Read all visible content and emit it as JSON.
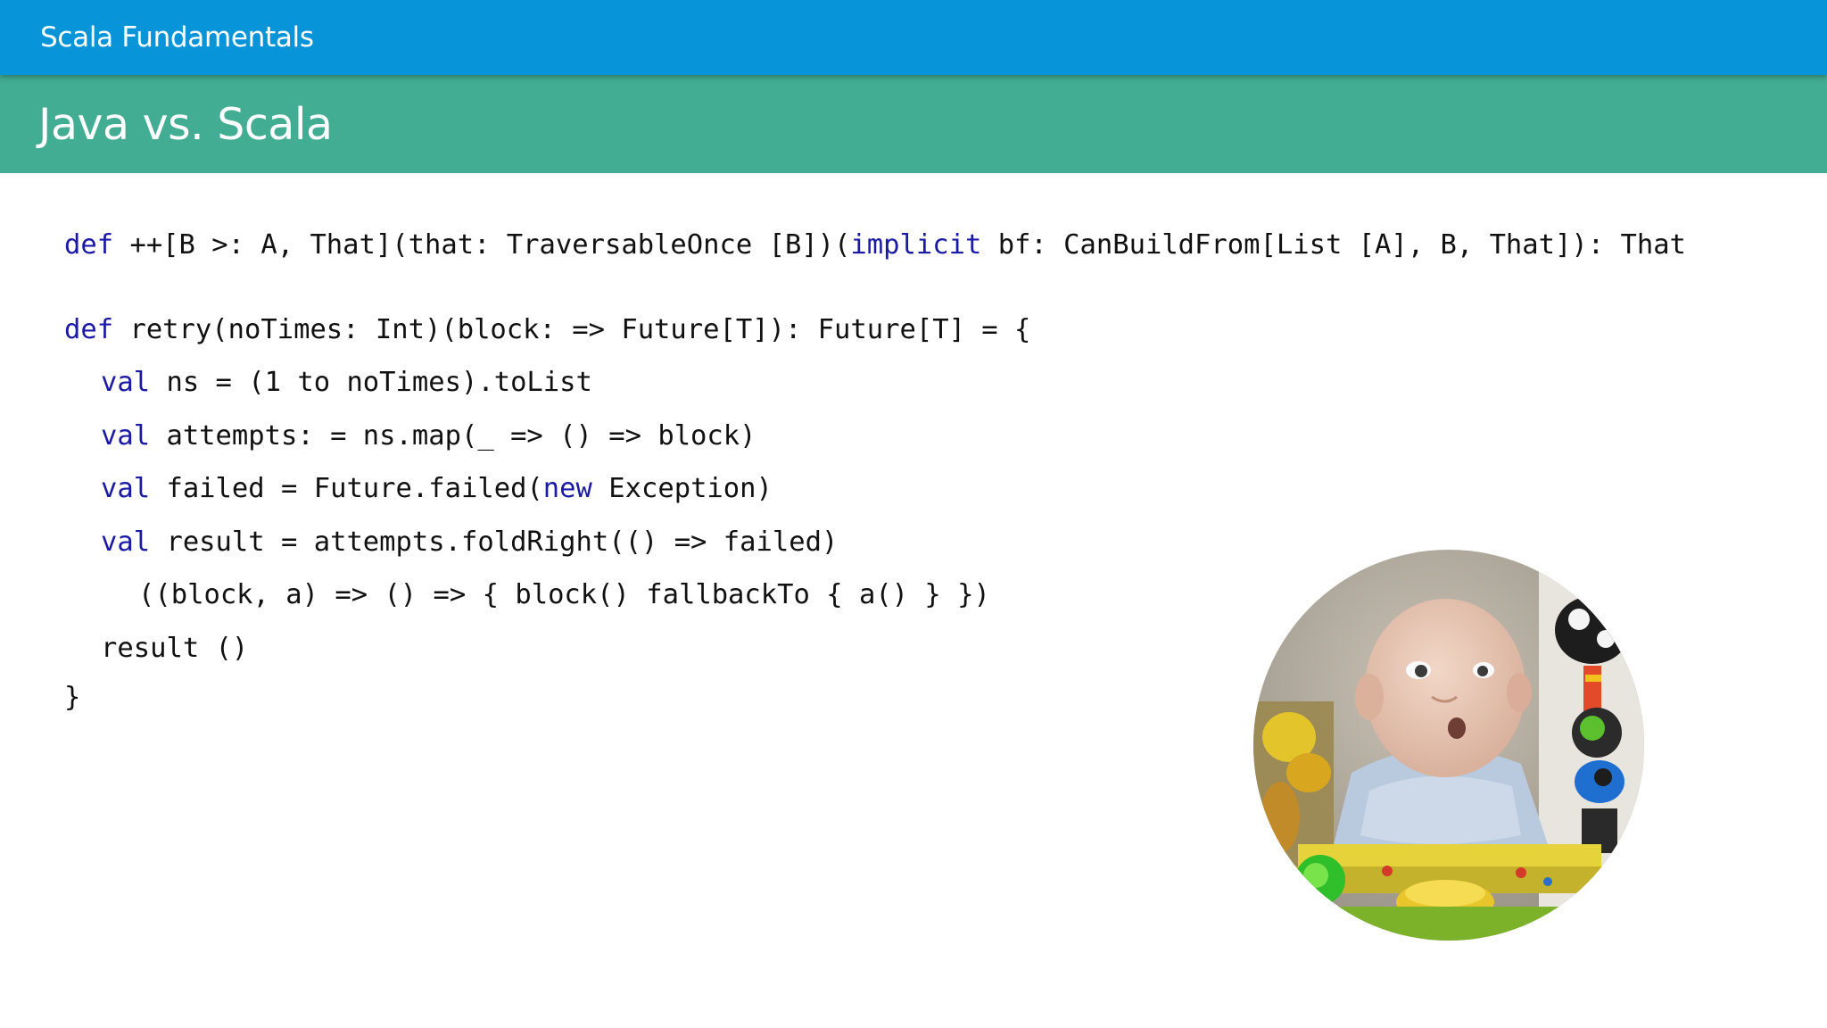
{
  "header": {
    "course_title": "Scala Fundamentals",
    "section_title": "Java vs. Scala"
  },
  "code": {
    "line1": {
      "kw1": "def",
      "t1": " ++[B >: A, That](that: TraversableOnce [B])(",
      "kw2": "implicit",
      "t2": " bf: CanBuildFrom[List [A], B, That]): That"
    },
    "line2": {
      "kw1": "def",
      "t1": " retry(noTimes: Int)(block: => Future[T]): Future[T] = {"
    },
    "line3": {
      "kw1": "val",
      "t1": " ns = (1 to noTimes).toList"
    },
    "line4": {
      "kw1": "val",
      "t1": " attempts: = ns.map(_ => () => block)"
    },
    "line5": {
      "kw1": "val",
      "t1": " failed = Future.failed(",
      "kw2": "new",
      "t2": " Exception)"
    },
    "line6": {
      "kw1": "val",
      "t1": " result = attempts.foldRight(() => failed)"
    },
    "line7": {
      "t1": "((block, a) => () => { block() fallbackTo { a() } })"
    },
    "line8": {
      "t1": "result ()"
    },
    "line9": {
      "t1": "}"
    }
  },
  "colors": {
    "course_bar": "#0794d8",
    "section_bar": "#42ad93",
    "keyword": "#1a1aa6"
  }
}
